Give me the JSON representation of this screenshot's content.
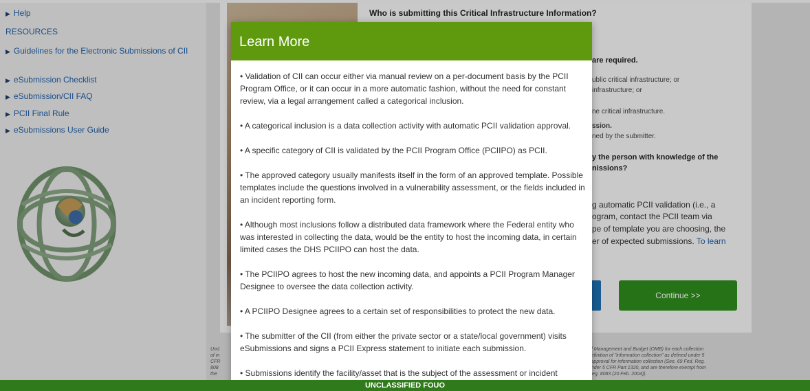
{
  "sidebar": {
    "help": "Help",
    "resources_heading": "RESOURCES",
    "items": [
      {
        "label": "Guidelines for the Electronic Submissions of CII"
      },
      {
        "label": "eSubmission Checklist"
      },
      {
        "label": "eSubmission/CII FAQ"
      },
      {
        "label": "PCII Final Rule"
      },
      {
        "label": "eSubmissions User Guide"
      }
    ]
  },
  "main": {
    "question_title": "Who is submitting this Critical Infrastructure Information?",
    "partial": {
      "required": "are required.",
      "line1": "ublic critical infrastructure; or",
      "line2": "infrastructure; or",
      "line3": "ne critical infrastructure.",
      "line4": "ssion.",
      "line5": "ned by the submitter.",
      "q2a": "y the person with knowledge of the",
      "q2b": "nissions?",
      "p1": "g automatic PCII validation (i.e., a",
      "p2": "ogram, contact the PCII team via",
      "p3": "pe of template you are choosing, the",
      "p4": "er of expected submissions.",
      "p4_link": "To learn"
    },
    "continue_label": "Continue >>",
    "legal": {
      "l1_left": "Und",
      "l1_right": "of Management and Budget (OMB) for each collection",
      "l2_left": "of in",
      "l2_right": "definition of \"information collection\" as defined under 5",
      "l3_left": "CFR",
      "l3_right": "l approval for information collection (See, 69 Fed. Reg.",
      "l4_left": "808",
      "l4_right": "under 5 CFR Part 1320, and are therefore exempt from",
      "l5_left": "the",
      "l5_right": "Reg. 8083 (20 Feb. 2004))."
    }
  },
  "modal": {
    "title": "Learn More",
    "paragraphs": [
      "• Validation of CII can occur either via manual review on a per-document basis by the PCII Program Office, or it can occur in a more automatic fashion, without the need for constant review, via a legal arrangement called a categorical inclusion.",
      "• A categorical inclusion is a data collection activity with automatic PCII validation approval.",
      "• A specific category of CII is validated by the PCII Program Office (PCIIPO) as PCII.",
      "• The approved category usually manifests itself in the form of an approved template. Possible templates include the questions involved in a vulnerability assessment, or the fields included in an incident reporting form.",
      "• Although most inclusions follow a distributed data framework where the Federal entity who was interested in collecting the data, would be the entity to host the incoming data, in certain limited cases the DHS PCIIPO can host the data.",
      "• The PCIIPO agrees to host the new incoming data, and appoints a PCII Program Manager Designee to oversee the data collection activity.",
      "• A PCIIPO Designee agrees to a certain set of responsibilities to protect the new data.",
      "• The submitter of the CII (from either the private sector or a state/local government) visits eSubmissions and signs a PCII Express statement to initiate each submission.",
      "• Submissions identify the facility/asset that is the subject of the assessment or incident"
    ]
  },
  "footer": {
    "classification": "UNCLASSIFIED FOUO"
  },
  "colors": {
    "modal_header": "#5f9a0e",
    "footer_bar": "#2f7a1a",
    "continue_button": "#2f8b1c",
    "link": "#1f5fa8"
  }
}
